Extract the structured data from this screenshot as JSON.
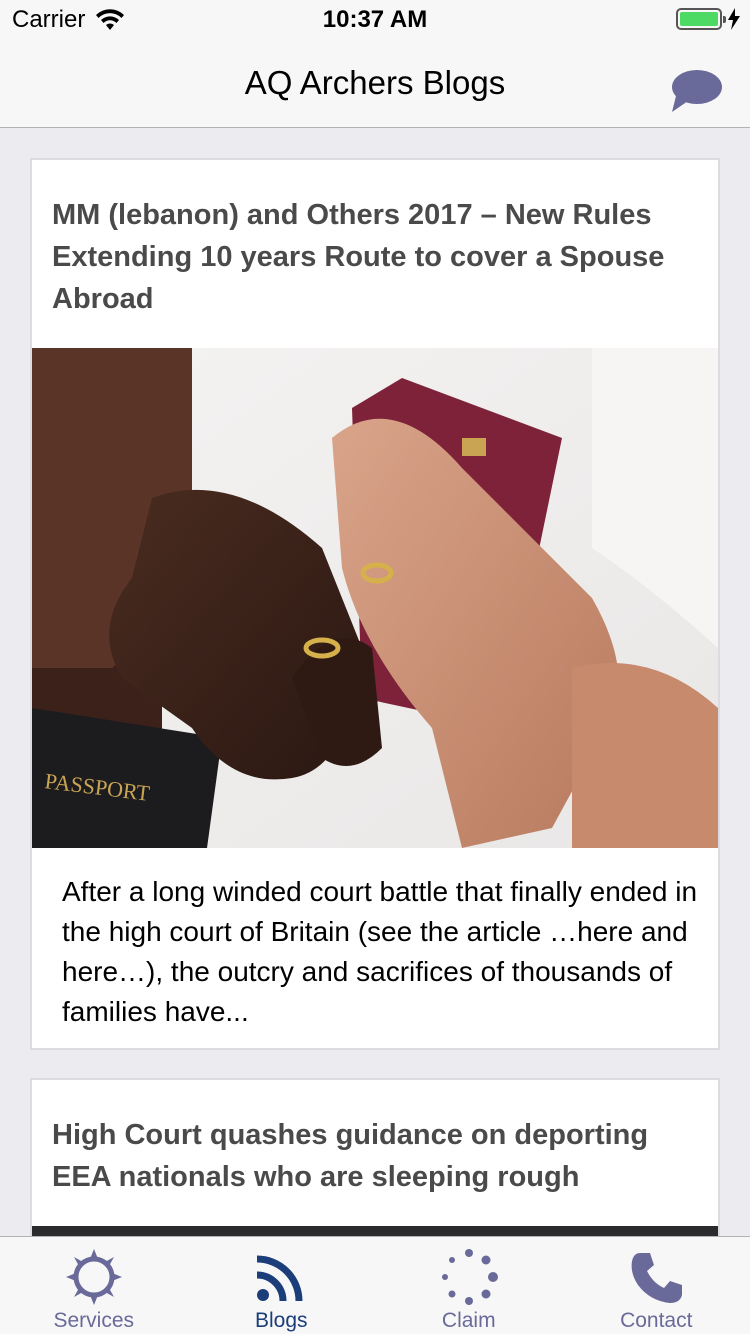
{
  "status_bar": {
    "carrier": "Carrier",
    "time": "10:37 AM",
    "battery_level": 1.0
  },
  "nav": {
    "title": "AQ Archers Blogs",
    "chat_icon": "chat-bubble-icon"
  },
  "posts": [
    {
      "title": "MM (lebanon) and Others 2017 – New Rules Extending 10 years Route to cover a Spouse Abroad",
      "image_caption_text": "PASSPORT",
      "excerpt": "After a long winded court battle that finally ended in the high court of Britain (see the article …here and here…), the outcry and sacrifices of thousands of families have..."
    },
    {
      "title": "High Court quashes guidance on deporting EEA nationals who are sleeping rough"
    }
  ],
  "tabs": [
    {
      "label": "Services",
      "icon": "gear-icon",
      "active": false
    },
    {
      "label": "Blogs",
      "icon": "rss-icon",
      "active": true
    },
    {
      "label": "Claim",
      "icon": "spinner-icon",
      "active": false
    },
    {
      "label": "Contact",
      "icon": "phone-icon",
      "active": false
    }
  ],
  "colors": {
    "accent": "#6a6a9a",
    "active_tab": "#1b3d7a",
    "title_text": "#4a4a4a",
    "battery": "#4cd964"
  }
}
